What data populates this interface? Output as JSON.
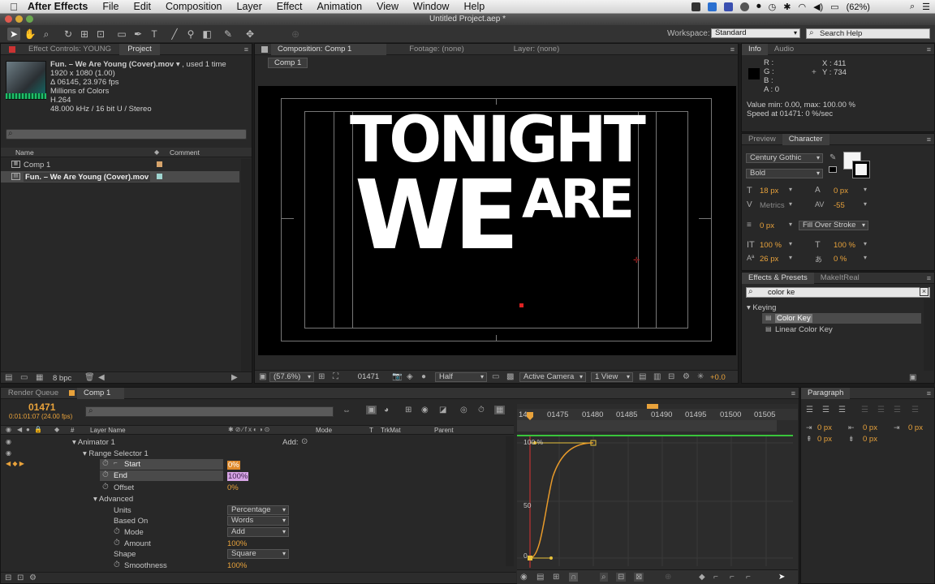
{
  "menubar": {
    "app": "After Effects",
    "items": [
      "File",
      "Edit",
      "Composition",
      "Layer",
      "Effect",
      "Animation",
      "View",
      "Window",
      "Help"
    ],
    "battery": "(62%)"
  },
  "window_title": "Untitled Project.aep *",
  "workspace": {
    "label": "Workspace:",
    "value": "Standard"
  },
  "search_help": {
    "placeholder": "Search Help"
  },
  "project_panel": {
    "tabs": [
      "Effect Controls: YOUNG",
      "Project"
    ],
    "item": {
      "name": "Fun. – We Are Young (Cover).mov",
      "used": ", used 1 time",
      "size": "1920 x 1080 (1.00)",
      "duration": "Δ 06145, 23.976 fps",
      "colors": "Millions of Colors",
      "codec": "H.264",
      "audio": "48.000 kHz / 16 bit U / Stereo"
    },
    "search_placeholder": "",
    "columns": [
      "Name",
      "Comment"
    ],
    "rows": [
      "Comp 1",
      "Fun. – We Are Young (Cover).mov"
    ],
    "bpc": "8 bpc"
  },
  "comp_panel": {
    "tabs": [
      "Composition: Comp 1",
      "Footage: (none)",
      "Layer: (none)"
    ],
    "subtab": "Comp 1",
    "text_line1": "TONIGHT",
    "text_line2a": "WE",
    "text_line2b": "ARE",
    "footer": {
      "zoom": "(57.6%)",
      "timecode": "01471",
      "resolution": "Half",
      "camera": "Active Camera",
      "views": "1 View",
      "exposure": "+0.0"
    }
  },
  "info_panel": {
    "tabs": [
      "Info",
      "Audio"
    ],
    "rgba": [
      "R :",
      "G :",
      "B :",
      "A : 0"
    ],
    "x": "X : 411",
    "y": "Y : 734",
    "value_line": "Value min: 0.00, max: 100.00 %",
    "speed_line": "Speed at 01471: 0 %/sec"
  },
  "character_panel": {
    "tabs": [
      "Preview",
      "Character"
    ],
    "font": "Century Gothic",
    "style": "Bold",
    "size": "18 px",
    "leading": "0 px",
    "kerning": "Metrics",
    "tracking": "-55",
    "stroke": "0 px",
    "stroke_mode": "Fill Over Stroke",
    "vscale": "100 %",
    "hscale": "100 %",
    "baseline": "26 px",
    "tsume": "0 %"
  },
  "effects_panel": {
    "tabs": [
      "Effects & Presets",
      "MakeItReal"
    ],
    "search": "color ke",
    "category": "Keying",
    "items": [
      "Color Key",
      "Linear Color Key"
    ]
  },
  "paragraph_panel": {
    "tab": "Paragraph",
    "values": [
      "0 px",
      "0 px",
      "0 px",
      "0 px",
      "0 px"
    ]
  },
  "timeline": {
    "tabs": [
      "Render Queue",
      "Comp 1"
    ],
    "timecode": "01471",
    "subtime": "0:01:01:07 (24.00 fps)",
    "columns": [
      "Layer Name",
      "Mode",
      "T",
      "TrkMat",
      "Parent"
    ],
    "add_label": "Add:",
    "rows": [
      {
        "name": "Animator 1",
        "value": ""
      },
      {
        "name": "Range Selector 1",
        "value": ""
      },
      {
        "name": "Start",
        "value": "0%"
      },
      {
        "name": "End",
        "value": "100%"
      },
      {
        "name": "Offset",
        "value": "0%"
      },
      {
        "name": "Advanced",
        "value": ""
      },
      {
        "name": "Units",
        "value": "Percentage"
      },
      {
        "name": "Based On",
        "value": "Words"
      },
      {
        "name": "Mode",
        "value": "Add"
      },
      {
        "name": "Amount",
        "value": "100%"
      },
      {
        "name": "Shape",
        "value": "Square"
      },
      {
        "name": "Smoothness",
        "value": "100%"
      }
    ],
    "ruler": [
      "14",
      "01475",
      "01480",
      "01485",
      "01490",
      "01495",
      "01500",
      "01505"
    ],
    "graph_labels": [
      "100 %",
      "50",
      "0"
    ]
  },
  "colors": {
    "accent": "#e8a23b",
    "bg": "#282828",
    "graph_curve": "#e89a2a",
    "range_bar": "#39c43b"
  }
}
